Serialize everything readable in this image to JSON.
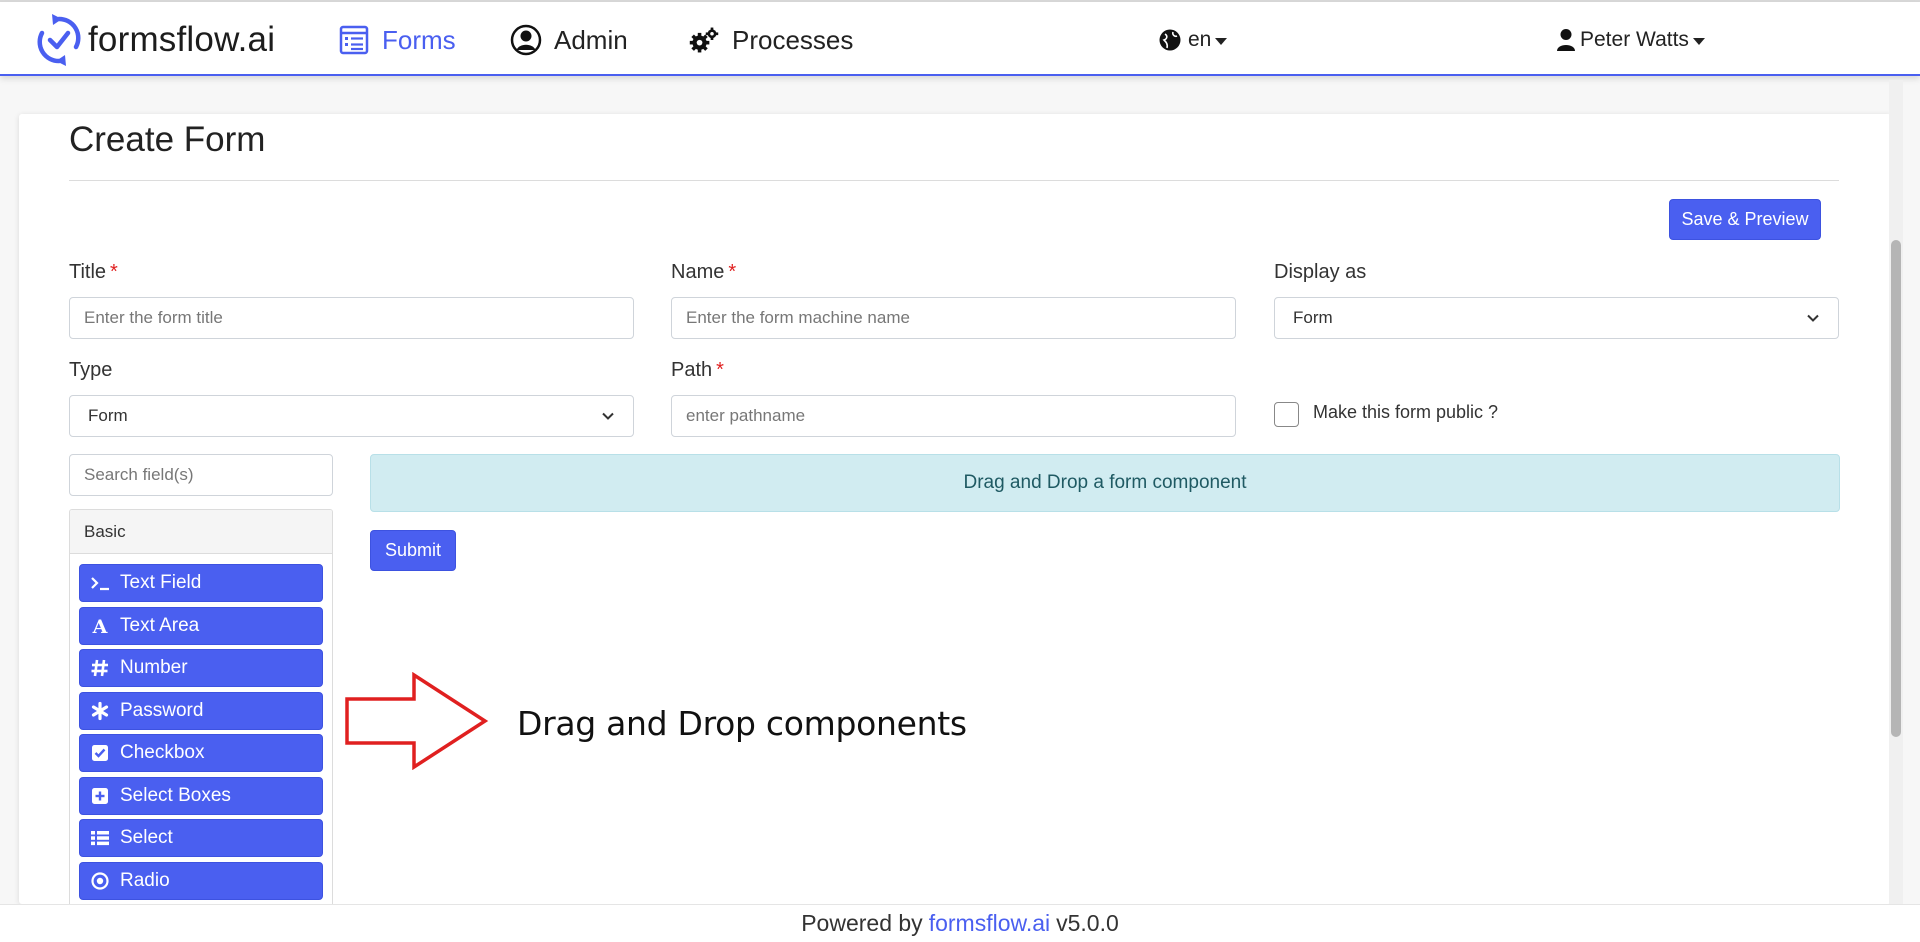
{
  "app": {
    "brand": "formsflow.ai",
    "accent_color": "#4a5ff0"
  },
  "nav": {
    "forms": "Forms",
    "admin": "Admin",
    "processes": "Processes",
    "language": "en",
    "user": "Peter Watts"
  },
  "page": {
    "title": "Create Form",
    "save_preview": "Save & Preview"
  },
  "form": {
    "title_label": "Title",
    "title_placeholder": "Enter the form title",
    "name_label": "Name",
    "name_placeholder": "Enter the form machine name",
    "display_label": "Display as",
    "display_value": "Form",
    "type_label": "Type",
    "type_value": "Form",
    "path_label": "Path",
    "path_placeholder": "enter pathname",
    "public_label": "Make this form public ?",
    "required_mark": "*"
  },
  "builder": {
    "search_placeholder": "Search field(s)",
    "group": "Basic",
    "components": [
      {
        "label": "Text Field",
        "icon": "terminal-icon"
      },
      {
        "label": "Text Area",
        "icon": "font-icon"
      },
      {
        "label": "Number",
        "icon": "hashtag-icon"
      },
      {
        "label": "Password",
        "icon": "asterisk-icon"
      },
      {
        "label": "Checkbox",
        "icon": "check-square-icon"
      },
      {
        "label": "Select Boxes",
        "icon": "plus-square-icon"
      },
      {
        "label": "Select",
        "icon": "list-icon"
      },
      {
        "label": "Radio",
        "icon": "dot-circle-icon"
      }
    ],
    "dropzone_text": "Drag and Drop a form component",
    "submit_label": "Submit"
  },
  "annotation": {
    "text": "Drag and Drop components",
    "color": "#e02020"
  },
  "footer": {
    "prefix": "Powered by",
    "link": "formsflow.ai",
    "version": "v5.0.0"
  }
}
